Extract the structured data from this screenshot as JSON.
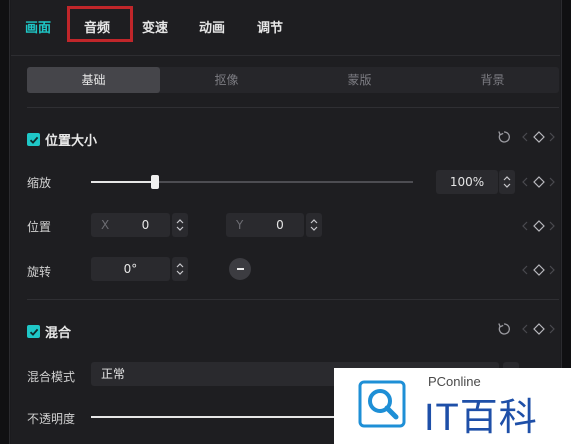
{
  "top_tabs": [
    "画面",
    "音频",
    "变速",
    "动画",
    "调节"
  ],
  "sub_tabs": [
    "基础",
    "抠像",
    "蒙版",
    "背景"
  ],
  "position_size": {
    "title": "位置大小",
    "scale_label": "缩放",
    "scale_value": "100%",
    "scale_level_percent": 100,
    "position_label": "位置",
    "x_prefix": "X",
    "x_value": "0",
    "y_prefix": "Y",
    "y_value": "0",
    "rotate_label": "旋转",
    "rotate_value": "0°"
  },
  "blend": {
    "title": "混合",
    "mode_label": "混合模式",
    "mode_value": "正常",
    "opacity_label": "不透明度"
  },
  "watermark": {
    "small": "PConline",
    "big": "IT百科"
  },
  "colors": {
    "accent": "#1fc7c7",
    "highlight_border": "#c0262a",
    "watermark_blue": "#1e4fa8"
  }
}
